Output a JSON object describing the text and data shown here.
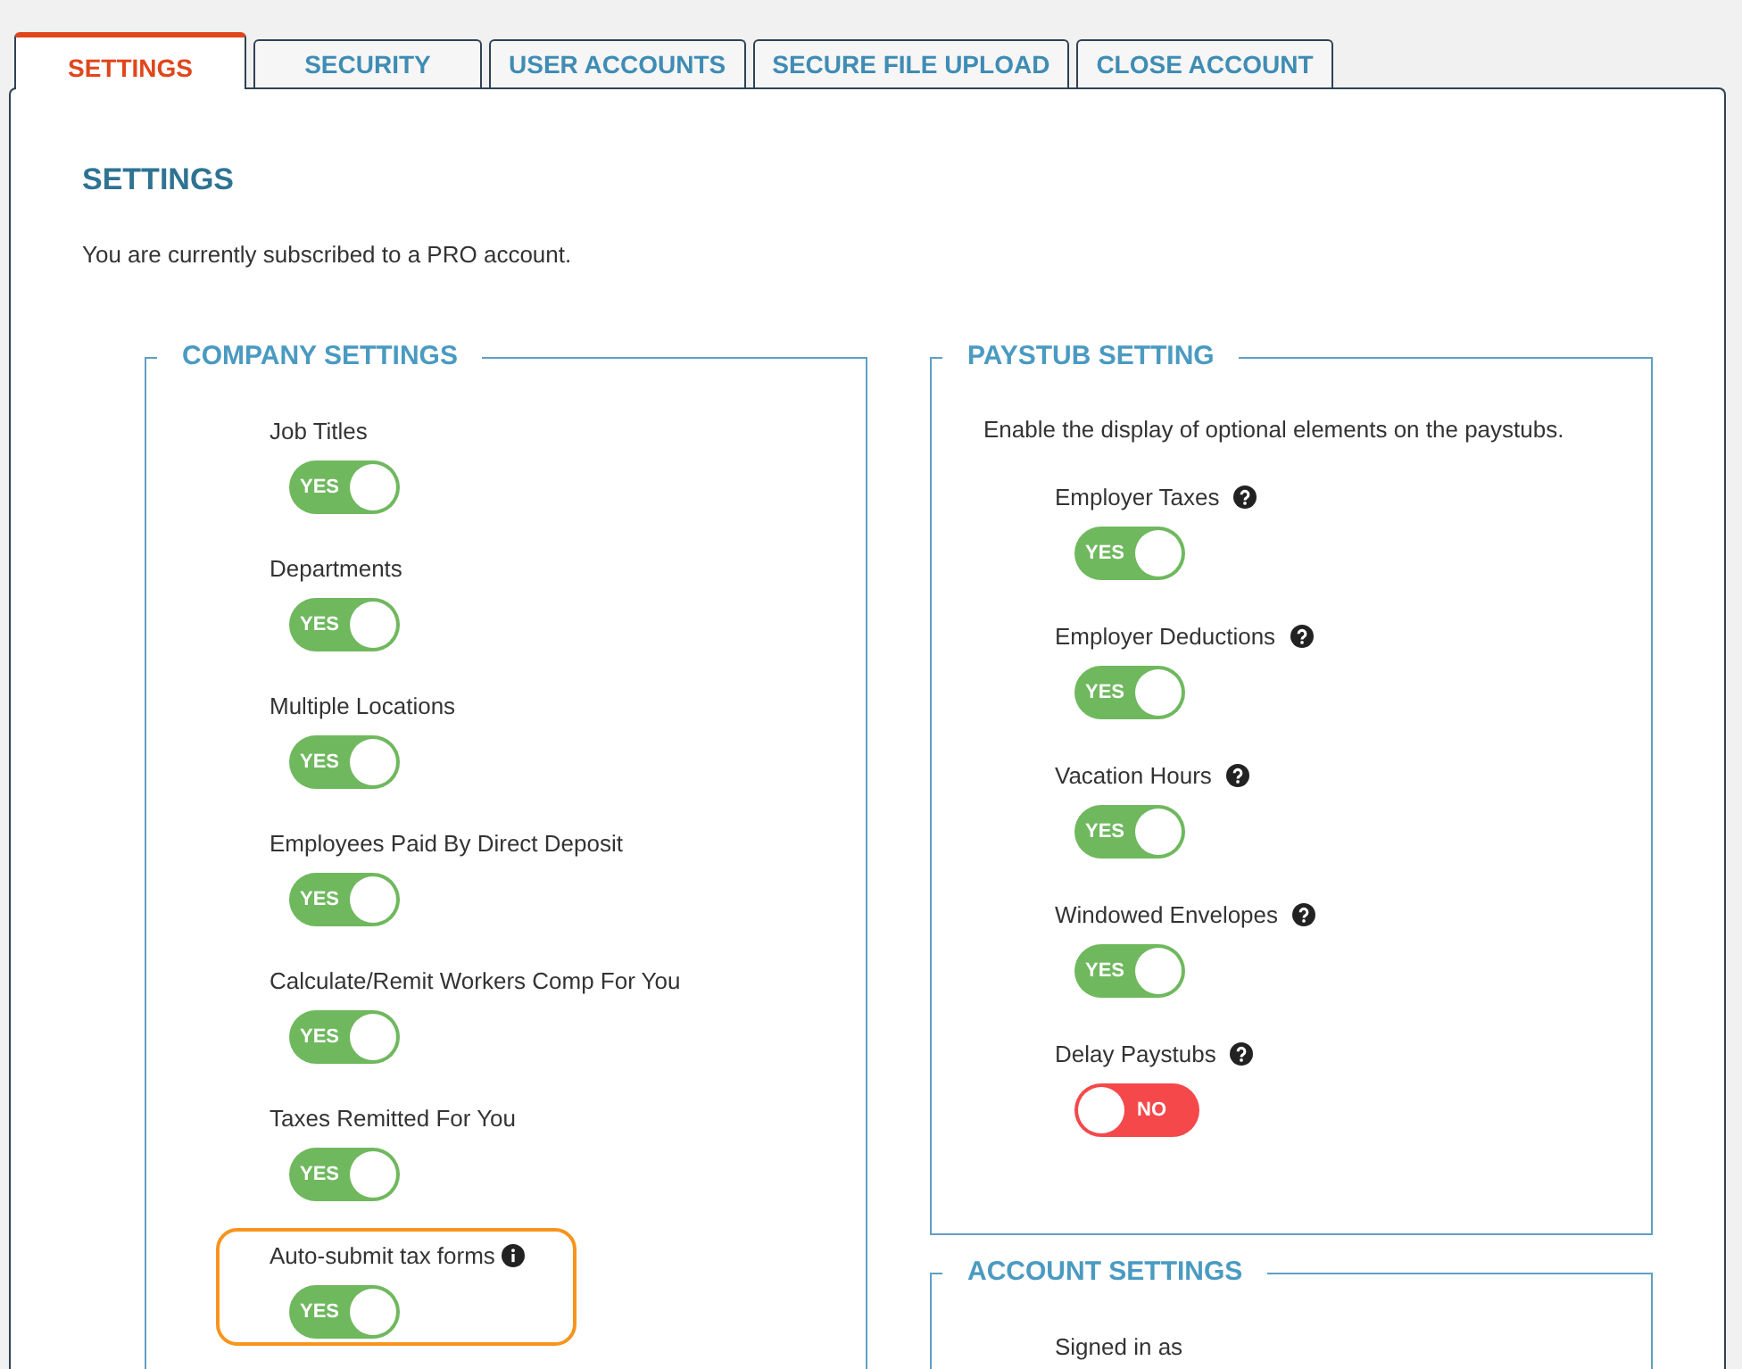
{
  "tabs": [
    {
      "label": "SETTINGS",
      "selected": true
    },
    {
      "label": "SECURITY",
      "selected": false
    },
    {
      "label": "USER ACCOUNTS",
      "selected": false
    },
    {
      "label": "SECURE FILE UPLOAD",
      "selected": false
    },
    {
      "label": "CLOSE ACCOUNT",
      "selected": false
    }
  ],
  "page": {
    "heading": "SETTINGS",
    "subscription_note": "You are currently subscribed to a PRO account."
  },
  "company_settings": {
    "legend": "COMPANY SETTINGS",
    "items": [
      {
        "label": "Job Titles",
        "tooltip": false,
        "on": true,
        "toggle_text": "YES",
        "highlighted": false
      },
      {
        "label": "Departments",
        "tooltip": false,
        "on": true,
        "toggle_text": "YES",
        "highlighted": false
      },
      {
        "label": "Multiple Locations",
        "tooltip": false,
        "on": true,
        "toggle_text": "YES",
        "highlighted": false
      },
      {
        "label": "Employees Paid By Direct Deposit",
        "tooltip": false,
        "on": true,
        "toggle_text": "YES",
        "highlighted": false
      },
      {
        "label": "Calculate/Remit Workers Comp For You",
        "tooltip": false,
        "on": true,
        "toggle_text": "YES",
        "highlighted": false
      },
      {
        "label": "Taxes Remitted For You",
        "tooltip": false,
        "on": true,
        "toggle_text": "YES",
        "highlighted": false
      },
      {
        "label": "Auto-submit tax forms",
        "tooltip": true,
        "on": true,
        "toggle_text": "YES",
        "highlighted": true
      }
    ]
  },
  "paystub_setting": {
    "legend": "PAYSTUB SETTING",
    "description": "Enable the display of optional elements on the paystubs.",
    "items": [
      {
        "label": "Employer Taxes",
        "tooltip": true,
        "on": true,
        "toggle_text": "YES",
        "highlighted": false
      },
      {
        "label": "Employer Deductions",
        "tooltip": true,
        "on": true,
        "toggle_text": "YES",
        "highlighted": false
      },
      {
        "label": "Vacation Hours",
        "tooltip": true,
        "on": true,
        "toggle_text": "YES",
        "highlighted": false
      },
      {
        "label": "Windowed Envelopes",
        "tooltip": true,
        "on": true,
        "toggle_text": "YES",
        "highlighted": false
      },
      {
        "label": "Delay Paystubs",
        "tooltip": true,
        "on": false,
        "toggle_text": "NO",
        "highlighted": false
      }
    ]
  },
  "account_settings": {
    "legend": "ACCOUNT SETTINGS",
    "fields": [
      {
        "label": "Signed in as"
      }
    ]
  }
}
